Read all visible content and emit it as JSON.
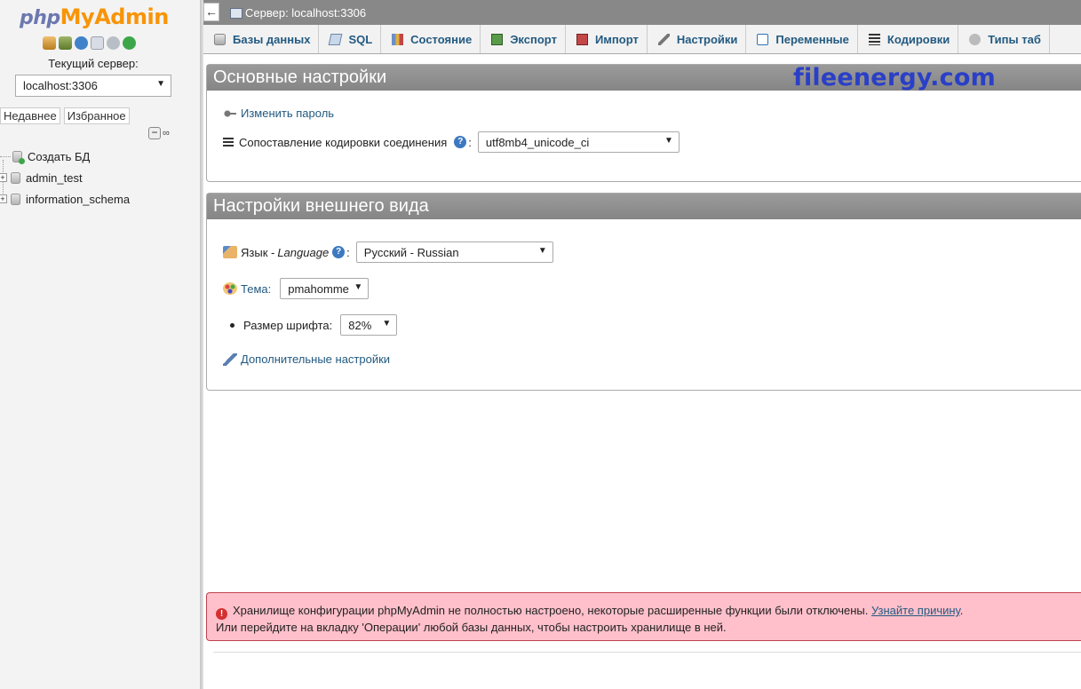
{
  "nav": {
    "logo": {
      "php": "php",
      "my": "My",
      "admin": "Admin"
    },
    "icons": [
      "home-icon",
      "exit-icon",
      "help-icon",
      "docs-icon",
      "settings-icon",
      "reload-icon"
    ],
    "current_server_label": "Текущий сервер:",
    "server_select": {
      "value": "localhost:3306"
    },
    "recent_tabs": [
      "Недавнее",
      "Избранное"
    ],
    "tree": [
      {
        "label": "Создать БД",
        "type": "new"
      },
      {
        "label": "admin_test",
        "type": "db"
      },
      {
        "label": "information_schema",
        "type": "db"
      }
    ]
  },
  "topbar": {
    "back": "←",
    "breadcrumb": "Сервер: localhost:3306"
  },
  "tabs": [
    {
      "label": "Базы данных",
      "icon": "database-icon"
    },
    {
      "label": "SQL",
      "icon": "sql-icon"
    },
    {
      "label": "Состояние",
      "icon": "status-icon"
    },
    {
      "label": "Экспорт",
      "icon": "export-icon"
    },
    {
      "label": "Импорт",
      "icon": "import-icon"
    },
    {
      "label": "Настройки",
      "icon": "wrench-icon"
    },
    {
      "label": "Переменные",
      "icon": "variables-icon"
    },
    {
      "label": "Кодировки",
      "icon": "charset-icon"
    },
    {
      "label": "Типы таб",
      "icon": "engines-icon"
    }
  ],
  "general": {
    "title": "Основные настройки",
    "change_password": "Изменить пароль",
    "collation_label": "Сопоставление кодировки соединения",
    "collation_value": "utf8mb4_unicode_ci",
    "help": "?"
  },
  "appearance": {
    "title": "Настройки внешнего вида",
    "language_label": "Язык - ",
    "language_label_italic": "Language",
    "language_value": "Русский - Russian",
    "theme_label": "Тема:",
    "theme_value": "pmahomme",
    "font_size_label": "Размер шрифта:",
    "font_size_value": "82%",
    "more_settings": "Дополнительные настройки"
  },
  "watermark": "fileenergy.com",
  "error": {
    "line1": "Хранилище конфигурации phpMyAdmin не полностью настроено, некоторые расширенные функции были отключены.",
    "link": "Узнайте причину",
    "line1_end": ".",
    "line2": "Или перейдите на вкладку 'Операции' любой базы данных, чтобы настроить хранилище в ней."
  },
  "colors": {
    "accent_link": "#235a81",
    "panel_head": "#8c8c8c",
    "error_bg": "#ffc0cb",
    "logo_orange": "#f89406"
  }
}
